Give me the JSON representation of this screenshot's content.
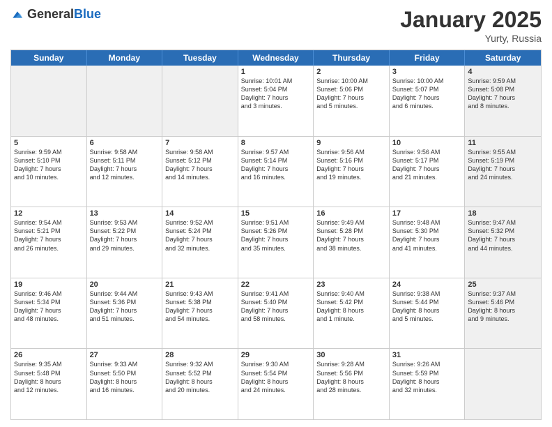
{
  "header": {
    "logo_general": "General",
    "logo_blue": "Blue",
    "month": "January 2025",
    "location": "Yurty, Russia"
  },
  "days_of_week": [
    "Sunday",
    "Monday",
    "Tuesday",
    "Wednesday",
    "Thursday",
    "Friday",
    "Saturday"
  ],
  "weeks": [
    [
      {
        "day": "",
        "detail": "",
        "shaded": true,
        "empty": true
      },
      {
        "day": "",
        "detail": "",
        "shaded": true,
        "empty": true
      },
      {
        "day": "",
        "detail": "",
        "shaded": true,
        "empty": true
      },
      {
        "day": "1",
        "detail": "Sunrise: 10:01 AM\nSunset: 5:04 PM\nDaylight: 7 hours\nand 3 minutes.",
        "shaded": false
      },
      {
        "day": "2",
        "detail": "Sunrise: 10:00 AM\nSunset: 5:06 PM\nDaylight: 7 hours\nand 5 minutes.",
        "shaded": false
      },
      {
        "day": "3",
        "detail": "Sunrise: 10:00 AM\nSunset: 5:07 PM\nDaylight: 7 hours\nand 6 minutes.",
        "shaded": false
      },
      {
        "day": "4",
        "detail": "Sunrise: 9:59 AM\nSunset: 5:08 PM\nDaylight: 7 hours\nand 8 minutes.",
        "shaded": true
      }
    ],
    [
      {
        "day": "5",
        "detail": "Sunrise: 9:59 AM\nSunset: 5:10 PM\nDaylight: 7 hours\nand 10 minutes.",
        "shaded": false
      },
      {
        "day": "6",
        "detail": "Sunrise: 9:58 AM\nSunset: 5:11 PM\nDaylight: 7 hours\nand 12 minutes.",
        "shaded": false
      },
      {
        "day": "7",
        "detail": "Sunrise: 9:58 AM\nSunset: 5:12 PM\nDaylight: 7 hours\nand 14 minutes.",
        "shaded": false
      },
      {
        "day": "8",
        "detail": "Sunrise: 9:57 AM\nSunset: 5:14 PM\nDaylight: 7 hours\nand 16 minutes.",
        "shaded": false
      },
      {
        "day": "9",
        "detail": "Sunrise: 9:56 AM\nSunset: 5:16 PM\nDaylight: 7 hours\nand 19 minutes.",
        "shaded": false
      },
      {
        "day": "10",
        "detail": "Sunrise: 9:56 AM\nSunset: 5:17 PM\nDaylight: 7 hours\nand 21 minutes.",
        "shaded": false
      },
      {
        "day": "11",
        "detail": "Sunrise: 9:55 AM\nSunset: 5:19 PM\nDaylight: 7 hours\nand 24 minutes.",
        "shaded": true
      }
    ],
    [
      {
        "day": "12",
        "detail": "Sunrise: 9:54 AM\nSunset: 5:21 PM\nDaylight: 7 hours\nand 26 minutes.",
        "shaded": false
      },
      {
        "day": "13",
        "detail": "Sunrise: 9:53 AM\nSunset: 5:22 PM\nDaylight: 7 hours\nand 29 minutes.",
        "shaded": false
      },
      {
        "day": "14",
        "detail": "Sunrise: 9:52 AM\nSunset: 5:24 PM\nDaylight: 7 hours\nand 32 minutes.",
        "shaded": false
      },
      {
        "day": "15",
        "detail": "Sunrise: 9:51 AM\nSunset: 5:26 PM\nDaylight: 7 hours\nand 35 minutes.",
        "shaded": false
      },
      {
        "day": "16",
        "detail": "Sunrise: 9:49 AM\nSunset: 5:28 PM\nDaylight: 7 hours\nand 38 minutes.",
        "shaded": false
      },
      {
        "day": "17",
        "detail": "Sunrise: 9:48 AM\nSunset: 5:30 PM\nDaylight: 7 hours\nand 41 minutes.",
        "shaded": false
      },
      {
        "day": "18",
        "detail": "Sunrise: 9:47 AM\nSunset: 5:32 PM\nDaylight: 7 hours\nand 44 minutes.",
        "shaded": true
      }
    ],
    [
      {
        "day": "19",
        "detail": "Sunrise: 9:46 AM\nSunset: 5:34 PM\nDaylight: 7 hours\nand 48 minutes.",
        "shaded": false
      },
      {
        "day": "20",
        "detail": "Sunrise: 9:44 AM\nSunset: 5:36 PM\nDaylight: 7 hours\nand 51 minutes.",
        "shaded": false
      },
      {
        "day": "21",
        "detail": "Sunrise: 9:43 AM\nSunset: 5:38 PM\nDaylight: 7 hours\nand 54 minutes.",
        "shaded": false
      },
      {
        "day": "22",
        "detail": "Sunrise: 9:41 AM\nSunset: 5:40 PM\nDaylight: 7 hours\nand 58 minutes.",
        "shaded": false
      },
      {
        "day": "23",
        "detail": "Sunrise: 9:40 AM\nSunset: 5:42 PM\nDaylight: 8 hours\nand 1 minute.",
        "shaded": false
      },
      {
        "day": "24",
        "detail": "Sunrise: 9:38 AM\nSunset: 5:44 PM\nDaylight: 8 hours\nand 5 minutes.",
        "shaded": false
      },
      {
        "day": "25",
        "detail": "Sunrise: 9:37 AM\nSunset: 5:46 PM\nDaylight: 8 hours\nand 9 minutes.",
        "shaded": true
      }
    ],
    [
      {
        "day": "26",
        "detail": "Sunrise: 9:35 AM\nSunset: 5:48 PM\nDaylight: 8 hours\nand 12 minutes.",
        "shaded": false
      },
      {
        "day": "27",
        "detail": "Sunrise: 9:33 AM\nSunset: 5:50 PM\nDaylight: 8 hours\nand 16 minutes.",
        "shaded": false
      },
      {
        "day": "28",
        "detail": "Sunrise: 9:32 AM\nSunset: 5:52 PM\nDaylight: 8 hours\nand 20 minutes.",
        "shaded": false
      },
      {
        "day": "29",
        "detail": "Sunrise: 9:30 AM\nSunset: 5:54 PM\nDaylight: 8 hours\nand 24 minutes.",
        "shaded": false
      },
      {
        "day": "30",
        "detail": "Sunrise: 9:28 AM\nSunset: 5:56 PM\nDaylight: 8 hours\nand 28 minutes.",
        "shaded": false
      },
      {
        "day": "31",
        "detail": "Sunrise: 9:26 AM\nSunset: 5:59 PM\nDaylight: 8 hours\nand 32 minutes.",
        "shaded": false
      },
      {
        "day": "",
        "detail": "",
        "shaded": true,
        "empty": true
      }
    ]
  ]
}
